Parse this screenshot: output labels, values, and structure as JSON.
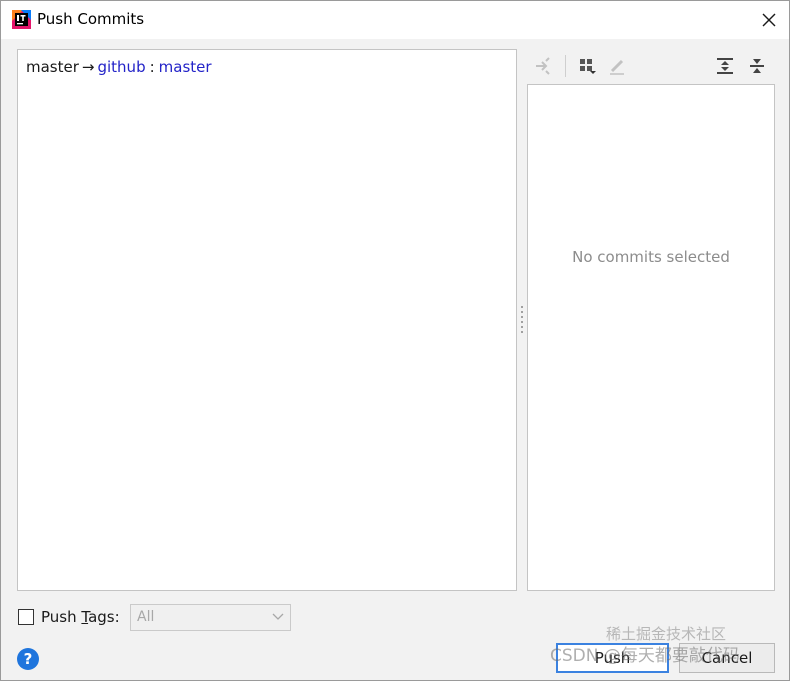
{
  "window": {
    "title": "Push Commits",
    "app_icon": "intellij-idea-icon",
    "close_icon": "close-icon"
  },
  "push_spec": {
    "local_branch": "master",
    "arrow": "→",
    "remote": "github",
    "separator": ":",
    "remote_branch": "master"
  },
  "details": {
    "toolbar_icons": [
      "cherry-pick-icon",
      "group-by-icon",
      "edit-icon",
      "expand-all-icon",
      "collapse-all-icon"
    ],
    "empty_text": "No commits selected"
  },
  "footer": {
    "push_tags_prefix": "Push ",
    "push_tags_mnemonic": "T",
    "push_tags_suffix": "ags:",
    "push_tags_checked": false,
    "tags_select_value": "All",
    "push_label": "Push",
    "cancel_label": "Cancel",
    "help_label": "?"
  },
  "watermark": {
    "line1": "CSDN @每天都要敲代码",
    "line2": "稀土掘金技术社区"
  },
  "colors": {
    "remote_link": "#2323c8",
    "primary_border": "#3b82e0",
    "help_blue": "#1f75dd"
  }
}
